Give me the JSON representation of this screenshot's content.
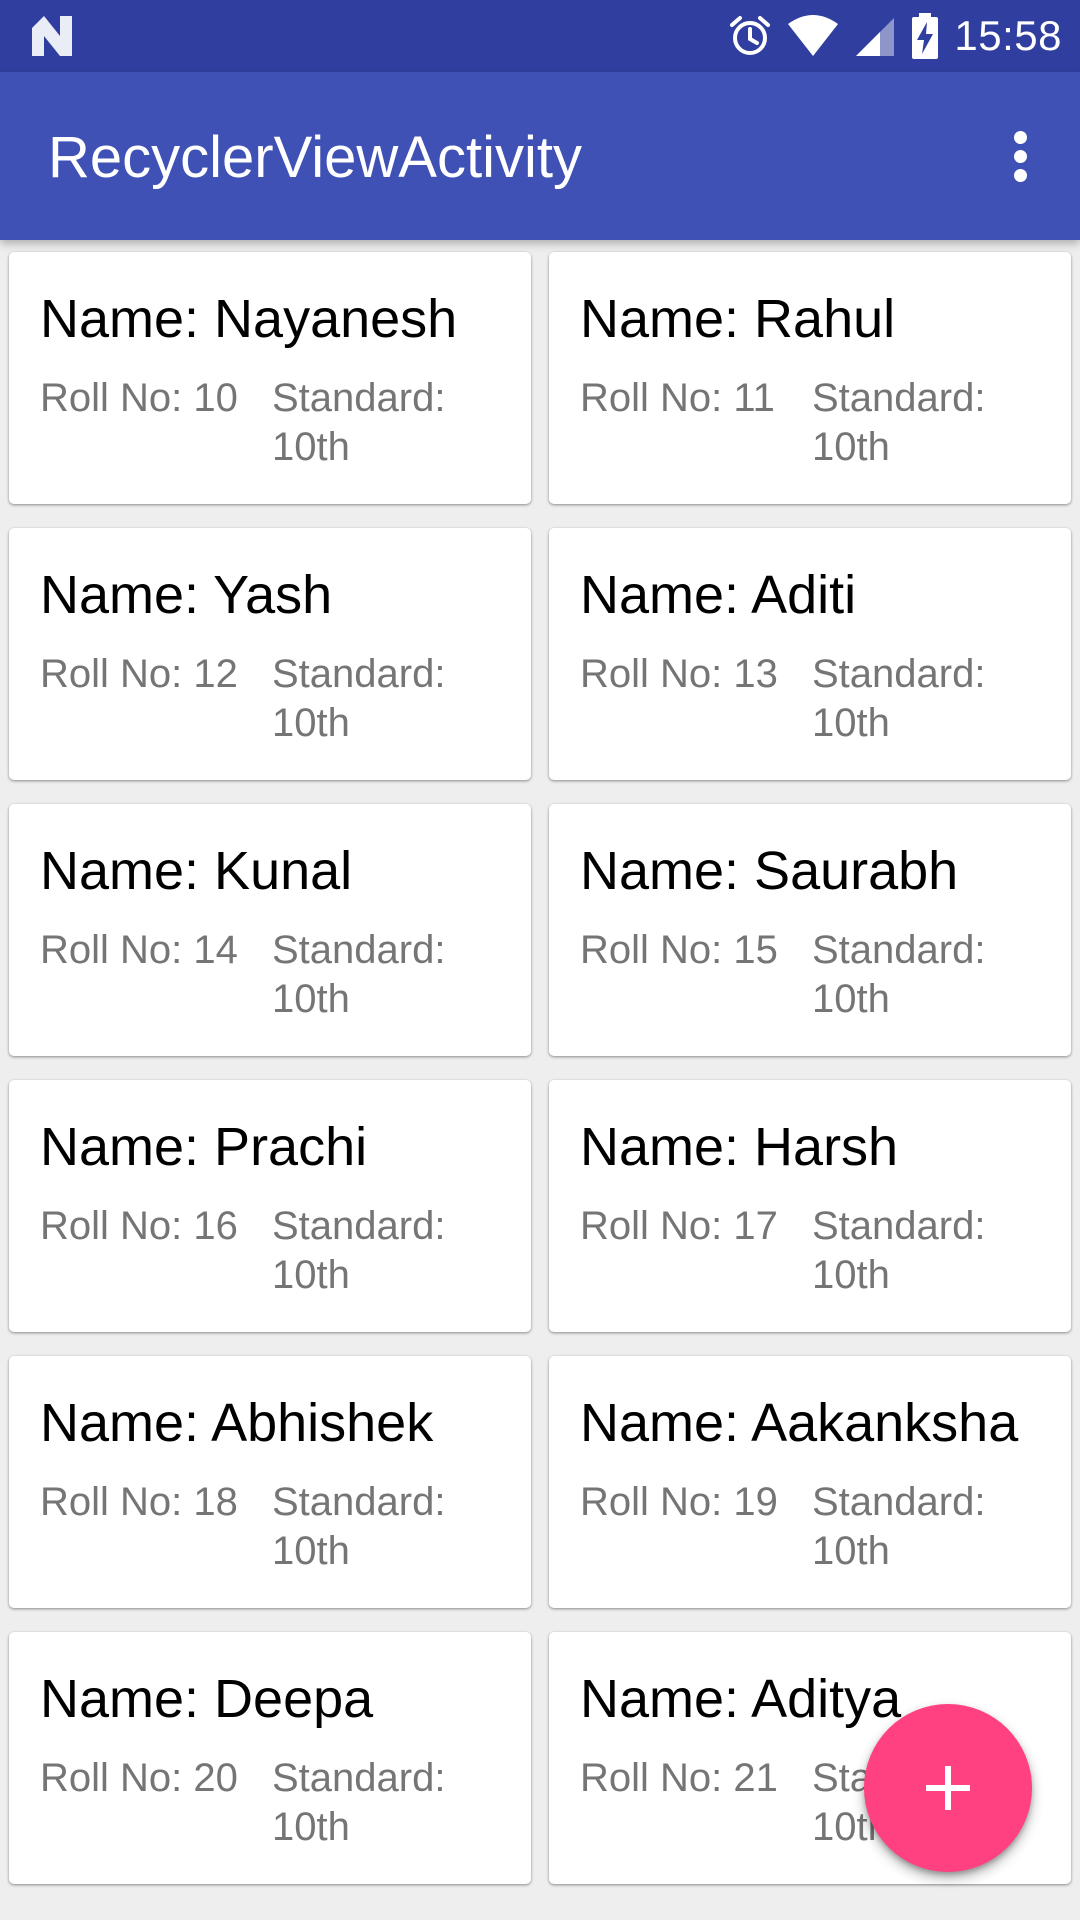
{
  "status_bar": {
    "time": "15:58",
    "icons": [
      "n-notification-icon",
      "alarm-icon",
      "wifi-icon",
      "cell-signal-icon",
      "battery-charging-icon"
    ],
    "color": "#303f9f"
  },
  "app_bar": {
    "title": "RecyclerViewActivity",
    "menu_icon": "more-vert-icon",
    "color": "#3f51b5"
  },
  "students": [
    {
      "name": "Name: Nayanesh",
      "roll": "Roll No: 10",
      "standard_label": "Standard:",
      "standard_value": "10th"
    },
    {
      "name": "Name: Rahul",
      "roll": "Roll No: 11",
      "standard_label": "Standard:",
      "standard_value": "10th"
    },
    {
      "name": "Name: Yash",
      "roll": "Roll No: 12",
      "standard_label": "Standard:",
      "standard_value": "10th"
    },
    {
      "name": "Name: Aditi",
      "roll": "Roll No: 13",
      "standard_label": "Standard:",
      "standard_value": "10th"
    },
    {
      "name": "Name: Kunal",
      "roll": "Roll No: 14",
      "standard_label": "Standard:",
      "standard_value": "10th"
    },
    {
      "name": "Name: Saurabh",
      "roll": "Roll No: 15",
      "standard_label": "Standard:",
      "standard_value": "10th"
    },
    {
      "name": "Name: Prachi",
      "roll": "Roll No: 16",
      "standard_label": "Standard:",
      "standard_value": "10th"
    },
    {
      "name": "Name: Harsh",
      "roll": "Roll No: 17",
      "standard_label": "Standard:",
      "standard_value": "10th"
    },
    {
      "name": "Name: Abhishek",
      "roll": "Roll No: 18",
      "standard_label": "Standard:",
      "standard_value": "10th"
    },
    {
      "name": "Name: Aakanksha",
      "roll": "Roll No: 19",
      "standard_label": "Standard:",
      "standard_value": "10th"
    },
    {
      "name": "Name: Deepa",
      "roll": "Roll No: 20",
      "standard_label": "Standard:",
      "standard_value": "10th"
    },
    {
      "name": "Name: Aditya",
      "roll": "Roll No: 21",
      "standard_label": "Standard:",
      "standard_value": "10th"
    }
  ],
  "fab": {
    "icon": "add-icon",
    "color": "#ff4081"
  }
}
